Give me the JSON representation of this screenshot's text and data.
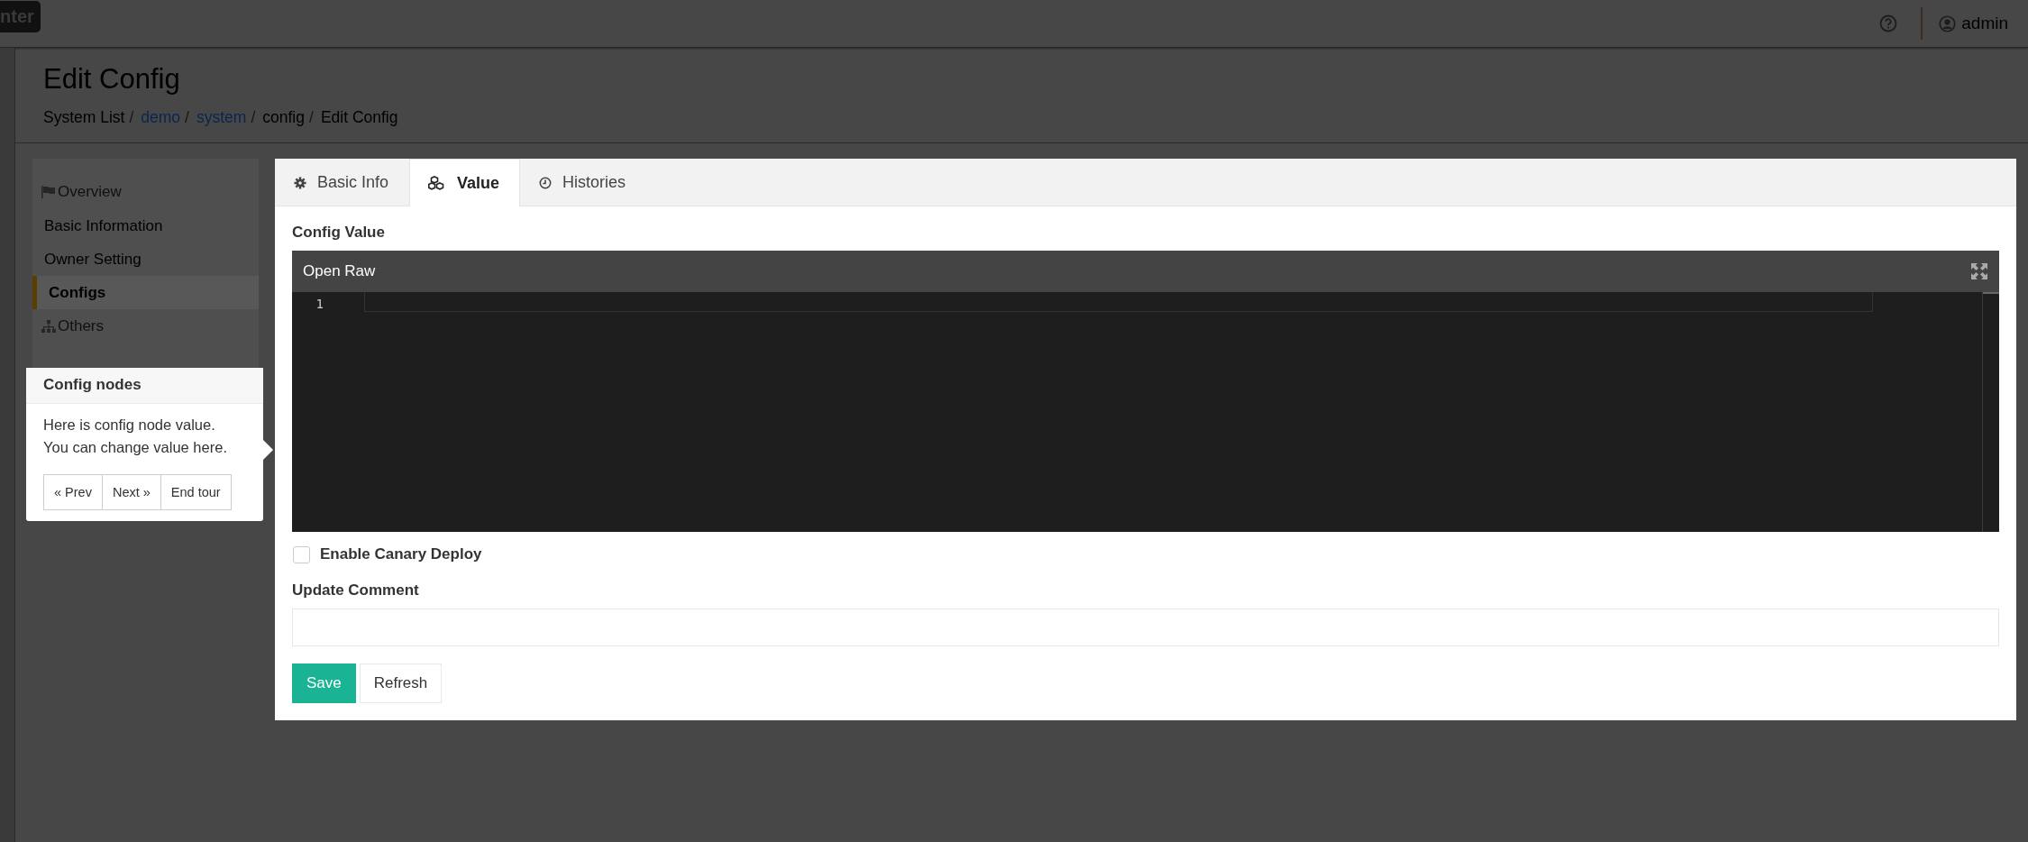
{
  "topbar": {
    "logo": "nter",
    "user": "admin"
  },
  "page": {
    "title": "Edit Config",
    "breadcrumb": [
      {
        "kind": "crumb",
        "label": "System List",
        "link": false
      },
      {
        "kind": "separator",
        "label": "/"
      },
      {
        "kind": "crumb",
        "label": "demo",
        "link": true
      },
      {
        "kind": "separator",
        "label": "/"
      },
      {
        "kind": "crumb",
        "label": "system",
        "link": true
      },
      {
        "kind": "separator",
        "label": "/"
      },
      {
        "kind": "crumb",
        "label": "config",
        "link": false
      },
      {
        "kind": "separator",
        "label": "/"
      },
      {
        "kind": "crumb",
        "label": "Edit Config",
        "link": false
      }
    ]
  },
  "sidebar": {
    "items": [
      {
        "kind": "header",
        "label": "Overview"
      },
      {
        "kind": "item",
        "label": "Basic Information",
        "selected": false
      },
      {
        "kind": "item",
        "label": "Owner Setting",
        "selected": false
      },
      {
        "kind": "item",
        "label": "Configs",
        "selected": true
      },
      {
        "kind": "header",
        "label": "Others"
      }
    ]
  },
  "tabs": [
    {
      "label": "Basic Info",
      "selected": false
    },
    {
      "label": "Value",
      "selected": true
    },
    {
      "label": "Histories",
      "selected": false
    }
  ],
  "form": {
    "value_label": "Config Value",
    "editor": {
      "title": "Open Raw",
      "line_numbers": [
        "1"
      ]
    },
    "canary": {
      "label": "Enable Canary Deploy",
      "checked": false
    },
    "comment_label": "Update Comment",
    "buttons": [
      {
        "label": "Save",
        "kind": "primary"
      },
      {
        "label": "Refresh",
        "kind": "default"
      }
    ]
  },
  "tour": {
    "title": "Config nodes",
    "body": "Here is config node value.\nYou can change value here.",
    "buttons": [
      "« Prev",
      "Next »",
      "End tour"
    ]
  }
}
